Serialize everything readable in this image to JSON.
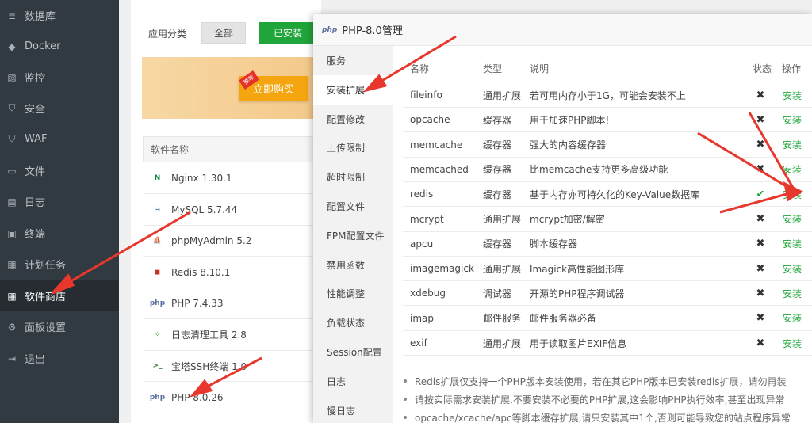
{
  "sidebar": {
    "items": [
      {
        "label": "数据库",
        "icon": "database-icon",
        "glyph": "≣"
      },
      {
        "label": "Docker",
        "icon": "docker-icon",
        "glyph": "◆"
      },
      {
        "label": "监控",
        "icon": "monitor-icon",
        "glyph": "▧"
      },
      {
        "label": "安全",
        "icon": "shield-icon",
        "glyph": "⛉"
      },
      {
        "label": "WAF",
        "icon": "waf-shield-icon",
        "glyph": "⛉"
      },
      {
        "label": "文件",
        "icon": "folder-icon",
        "glyph": "▭"
      },
      {
        "label": "日志",
        "icon": "log-icon",
        "glyph": "▤"
      },
      {
        "label": "终端",
        "icon": "terminal-icon",
        "glyph": "▣"
      },
      {
        "label": "计划任务",
        "icon": "calendar-icon",
        "glyph": "▦"
      },
      {
        "label": "软件商店",
        "icon": "apps-grid-icon",
        "glyph": "▦"
      },
      {
        "label": "面板设置",
        "icon": "gear-icon",
        "glyph": "⚙"
      },
      {
        "label": "退出",
        "icon": "logout-icon",
        "glyph": "⇥"
      }
    ],
    "active_index": 9
  },
  "store": {
    "filter_label": "应用分类",
    "filter_all": "全部",
    "filter_installed": "已安装",
    "buy_button": "立即购买",
    "hot_tag": "推荐",
    "list_header": "软件名称",
    "software": [
      {
        "name": "Nginx 1.30.1",
        "icon": "nginx-icon",
        "glyph": "N",
        "color": "#0a8a3a"
      },
      {
        "name": "MySQL 5.7.44",
        "icon": "mysql-icon",
        "glyph": "♒",
        "color": "#4a6d8c"
      },
      {
        "name": "phpMyAdmin 5.2",
        "icon": "phpmyadmin-icon",
        "glyph": "⛵",
        "color": "#e79c1b"
      },
      {
        "name": "Redis 8.10.1",
        "icon": "redis-icon",
        "glyph": "◼",
        "color": "#c6302b"
      },
      {
        "name": "PHP 7.4.33",
        "icon": "php-icon",
        "glyph": "php",
        "color": "#5b6f9e"
      },
      {
        "name": "日志清理工具 2.8",
        "icon": "broom-icon",
        "glyph": "✧",
        "color": "#2e9b3f"
      },
      {
        "name": "宝塔SSH终端 1.0",
        "icon": "terminal-icon",
        "glyph": ">_",
        "color": "#2e7d32"
      },
      {
        "name": "PHP 8.0.26",
        "icon": "php-icon",
        "glyph": "php",
        "color": "#5b6f9e"
      }
    ]
  },
  "modal": {
    "title": "PHP-8.0管理",
    "logo_text": "php",
    "nav": [
      "服务",
      "安装扩展",
      "配置修改",
      "上传限制",
      "超时限制",
      "配置文件",
      "FPM配置文件",
      "禁用函数",
      "性能调整",
      "负载状态",
      "Session配置",
      "日志",
      "慢日志"
    ],
    "active_nav_index": 1,
    "table": {
      "headers": {
        "name": "名称",
        "type": "类型",
        "desc": "说明",
        "status": "状态",
        "action": "操作"
      },
      "rows": [
        {
          "name": "fileinfo",
          "type": "通用扩展",
          "desc": "若可用内存小于1G，可能会安装不上",
          "installed": false,
          "action": "安装"
        },
        {
          "name": "opcache",
          "type": "缓存器",
          "desc": "用于加速PHP脚本!",
          "installed": false,
          "action": "安装"
        },
        {
          "name": "memcache",
          "type": "缓存器",
          "desc": "强大的内容缓存器",
          "installed": false,
          "action": "安装"
        },
        {
          "name": "memcached",
          "type": "缓存器",
          "desc": "比memcache支持更多高级功能",
          "installed": false,
          "action": "安装"
        },
        {
          "name": "redis",
          "type": "缓存器",
          "desc": "基于内存亦可持久化的Key-Value数据库",
          "installed": true,
          "action": "安装"
        },
        {
          "name": "mcrypt",
          "type": "通用扩展",
          "desc": "mcrypt加密/解密",
          "installed": false,
          "action": "安装"
        },
        {
          "name": "apcu",
          "type": "缓存器",
          "desc": "脚本缓存器",
          "installed": false,
          "action": "安装"
        },
        {
          "name": "imagemagick",
          "type": "通用扩展",
          "desc": "Imagick高性能图形库",
          "installed": false,
          "action": "安装"
        },
        {
          "name": "xdebug",
          "type": "调试器",
          "desc": "开源的PHP程序调试器",
          "installed": false,
          "action": "安装"
        },
        {
          "name": "imap",
          "type": "邮件服务",
          "desc": "邮件服务器必备",
          "installed": false,
          "action": "安装"
        },
        {
          "name": "exif",
          "type": "通用扩展",
          "desc": "用于读取图片EXIF信息",
          "installed": false,
          "action": "安装"
        }
      ]
    },
    "notes": [
      "Redis扩展仅支持一个PHP版本安装使用，若在其它PHP版本已安装redis扩展，请勿再装",
      "请按实际需求安装扩展,不要安装不必要的PHP扩展,这会影响PHP执行效率,甚至出现异常",
      "opcache/xcache/apc等脚本缓存扩展,请只安装其中1个,否则可能导致您的站点程序异常"
    ]
  },
  "colors": {
    "accent": "#20a53a",
    "sidebar_bg": "#313a41",
    "arrow": "#e8372c",
    "buy": "#f4a510"
  }
}
